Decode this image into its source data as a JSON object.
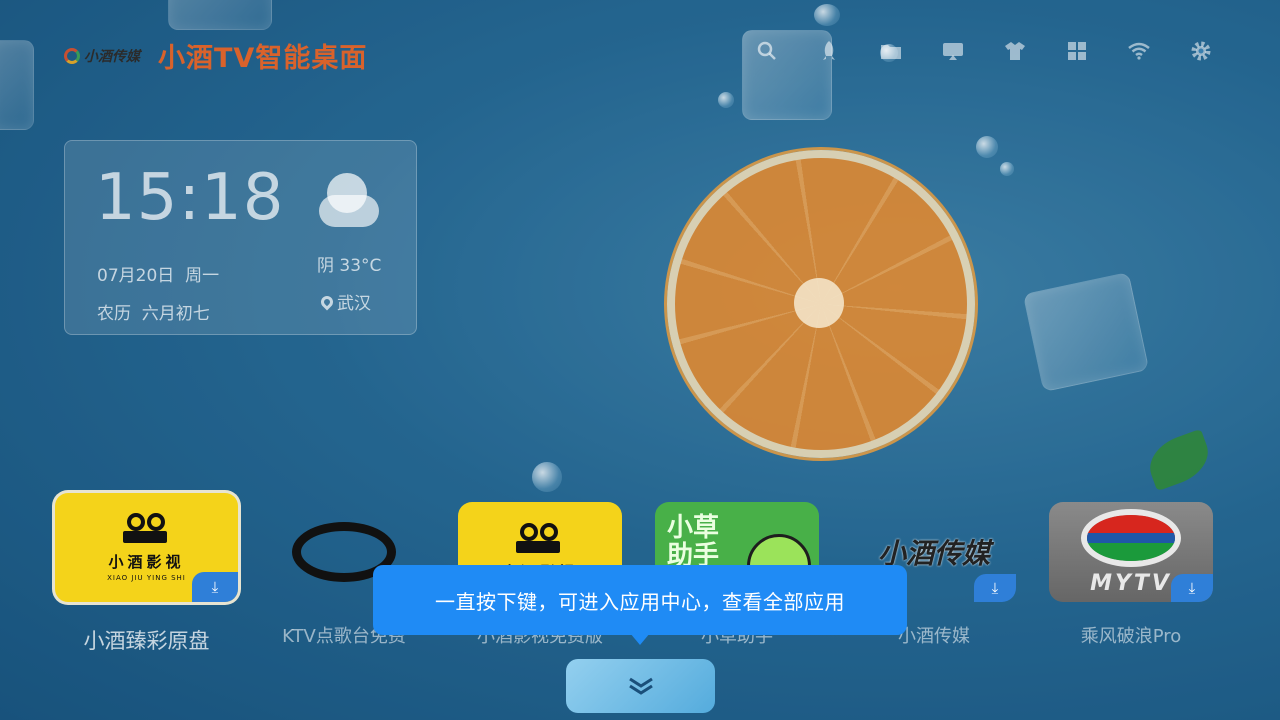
{
  "header": {
    "brand_small": "小酒传媒",
    "brand_title": "小酒TV智能桌面",
    "icons": [
      "search-icon",
      "rocket-icon",
      "folder-icon",
      "cast-icon",
      "tshirt-icon",
      "apps-grid-icon",
      "wifi-icon",
      "gear-icon"
    ]
  },
  "clock": {
    "time": "15:18",
    "date": "07月20日  周一",
    "lunar": "农历  六月初七",
    "weather": "阴 33°C",
    "location": "武汉"
  },
  "apps": [
    {
      "label": "小酒臻彩原盘",
      "tile_title": "小酒影视",
      "tile_sub": "XIAO JIU YING SHI"
    },
    {
      "label": "KTV点歌台免费"
    },
    {
      "label": "小酒影视免费版",
      "tile_title": "小酒影视"
    },
    {
      "label": "小草助手",
      "tile_text": "小草助手"
    },
    {
      "label": "小酒传媒",
      "tile_text": "小酒传媒"
    },
    {
      "label": "乘风破浪Pro",
      "tile_text": "MYTV"
    }
  ],
  "tooltip": {
    "text": "一直按下键，可进入应用中心，查看全部应用"
  },
  "colors": {
    "accent": "#1f8bf5",
    "brand": "#d9622b",
    "app_yellow": "#f4d31a",
    "app_green": "#48b048"
  }
}
